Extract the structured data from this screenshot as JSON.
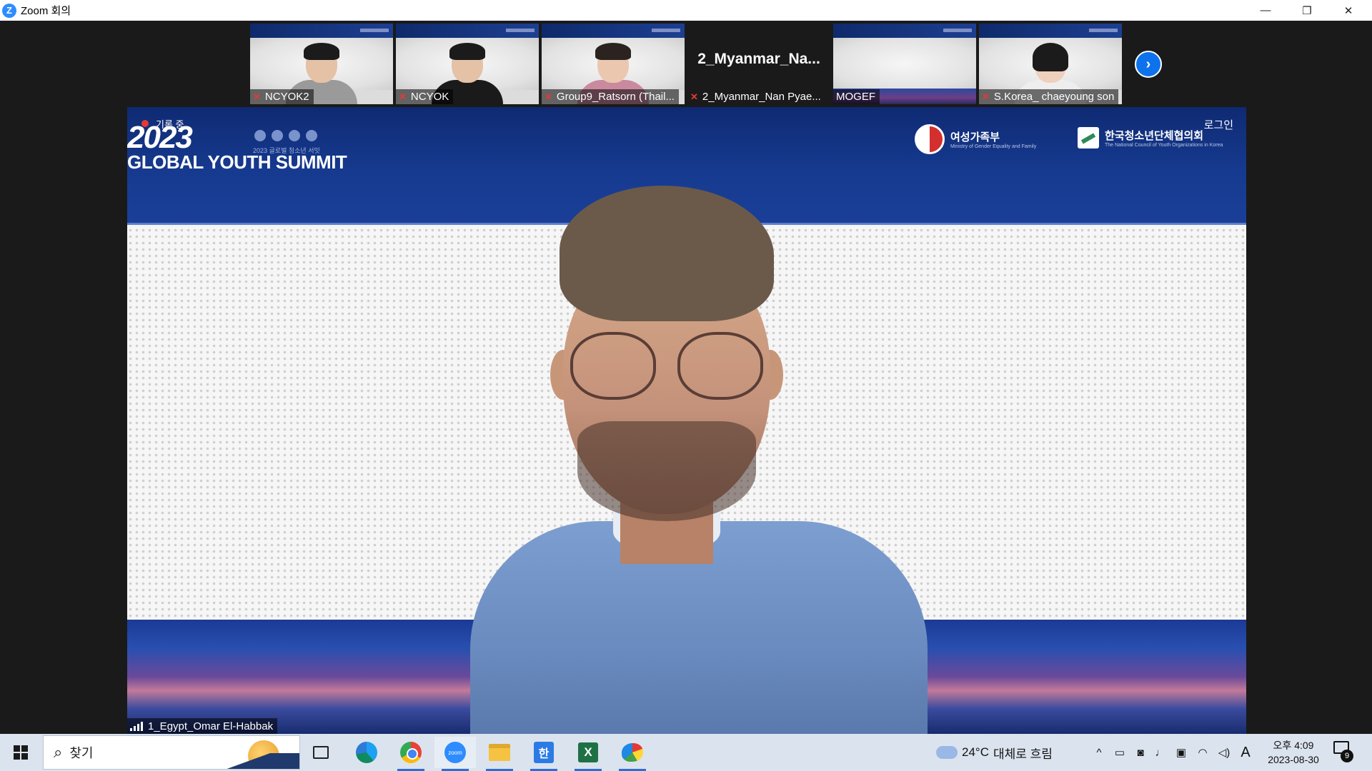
{
  "window": {
    "title": "Zoom 회의",
    "logo_letter": "Z",
    "minimize": "—",
    "restore": "❐",
    "close": "✕"
  },
  "thumbnails": [
    {
      "name": "NCYOK2",
      "muted": true,
      "has_video": true,
      "shirt_color": "#9a9a9a"
    },
    {
      "name": "NCYOK",
      "muted": true,
      "has_video": true,
      "shirt_color": "#1a1a1a"
    },
    {
      "name": "Group9_Ratsorn (Thail...",
      "muted": true,
      "has_video": true,
      "shirt_color": "#c98aa0"
    },
    {
      "name": "2_Myanmar_Nan Pyae...",
      "display_name": "2_Myanmar_Na...",
      "muted": true,
      "has_video": false
    },
    {
      "name": "MOGEF",
      "muted": false,
      "has_video": true,
      "shirt_color": null
    },
    {
      "name": "S.Korea_ chaeyoung son",
      "muted": true,
      "has_video": true,
      "shirt_color": "#eeeeee"
    }
  ],
  "next_page_icon": "chevron-right",
  "main_video": {
    "speaker_name": "1_Egypt_Omar El-Habbak",
    "banner": {
      "year": "2023",
      "event": "GLOBAL YOUTH SUMMIT",
      "sub_korean": "2023 글로벌 청소년 서밋",
      "recording_label": "기록 중",
      "login": "로그인",
      "ministry_name": "여성가족부",
      "ministry_sub": "Ministry of Gender Equality and Family",
      "council_name": "한국청소년단체협의회",
      "council_sub": "The National Council of Youth Organizations in Korea"
    }
  },
  "taskbar": {
    "search_placeholder": "찾기",
    "apps": [
      "task-view",
      "edge",
      "chrome",
      "zoom",
      "file-explorer",
      "hancom-word",
      "excel",
      "paint"
    ],
    "zoom_icon_label": "zoom",
    "hancom_icon_label": "한",
    "excel_icon_label": "X",
    "weather": {
      "temp": "24°C",
      "condition": "대체로 흐림"
    },
    "tray_chevron": "^",
    "ime": "A",
    "clock": {
      "time": "오후 4:09",
      "date": "2023-08-30"
    },
    "notifications": "9"
  }
}
